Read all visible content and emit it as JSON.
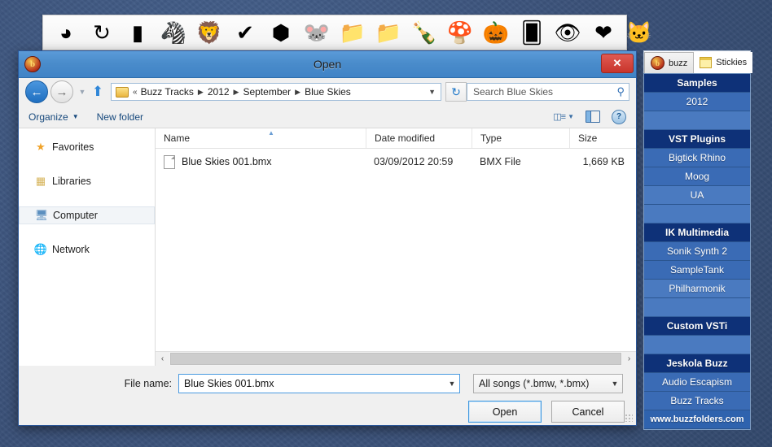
{
  "dock": {
    "icons": [
      {
        "name": "chrome-pie-icon",
        "glyph": "◕"
      },
      {
        "name": "recycle-arrows-icon",
        "glyph": "↻"
      },
      {
        "name": "equalizer-chart-icon",
        "glyph": "▮"
      },
      {
        "name": "zebra-icon",
        "glyph": "🦓"
      },
      {
        "name": "lion-icon",
        "glyph": "🦁"
      },
      {
        "name": "checkmark-monitor-icon",
        "glyph": "✔"
      },
      {
        "name": "colored-cubes-icon",
        "glyph": "⬢"
      },
      {
        "name": "mouse-character-icon",
        "glyph": "🐭"
      },
      {
        "name": "dropbox-folder-icon",
        "glyph": "📁"
      },
      {
        "name": "download-folder-icon",
        "glyph": "📁"
      },
      {
        "name": "whiskey-bottle-icon",
        "glyph": "🍾"
      },
      {
        "name": "mushroom-icon",
        "glyph": "🍄"
      },
      {
        "name": "pumpkin-icon",
        "glyph": "🎃"
      },
      {
        "name": "playing-cards-icon",
        "glyph": "🂠"
      },
      {
        "name": "eye-icon",
        "glyph": "👁"
      },
      {
        "name": "heart-icon",
        "glyph": "❤"
      },
      {
        "name": "cat-icon",
        "glyph": "🐱"
      }
    ]
  },
  "dialog": {
    "title": "Open",
    "title_icon": "b",
    "close_label": "✕",
    "nav": {
      "back_label": "←",
      "forward_label": "→",
      "history_label": "▼",
      "up_label": "⬆",
      "refresh_label": "↻",
      "address_dropdown": "▼",
      "breadcrumb_prefix": "«",
      "breadcrumbs": [
        "Buzz Tracks",
        "2012",
        "September",
        "Blue Skies"
      ],
      "crumb_separator": "▶"
    },
    "search": {
      "placeholder": "Search Blue Skies",
      "value": "",
      "icon": "search-icon"
    },
    "commands": {
      "organize": "Organize",
      "organize_caret": "▼",
      "new_folder": "New folder",
      "view_caret": "▼",
      "help_label": "?"
    },
    "nav_pane": [
      {
        "label": "Favorites",
        "icon": "star-icon",
        "glyph": "★",
        "selected": false
      },
      {
        "label": "Libraries",
        "icon": "libraries-icon",
        "glyph": "▤",
        "selected": false
      },
      {
        "label": "Computer",
        "icon": "computer-icon",
        "glyph": "🖳",
        "selected": true
      },
      {
        "label": "Network",
        "icon": "network-icon",
        "glyph": "🌐",
        "selected": false
      }
    ],
    "columns": [
      "Name",
      "Date modified",
      "Type",
      "Size"
    ],
    "sort_indicator": "▲",
    "files": [
      {
        "name": "Blue Skies 001.bmx",
        "date_modified": "03/09/2012 20:59",
        "type": "BMX File",
        "size": "1,669 KB"
      }
    ],
    "scrollbar": {
      "left_arrow": "‹",
      "right_arrow": "›"
    },
    "footer": {
      "filename_label": "File name:",
      "filename_value": "Blue Skies 001.bmx",
      "filename_caret": "▼",
      "filter_value": "All songs (*.bmw, *.bmx)",
      "filter_caret": "▼",
      "open_label": "Open",
      "cancel_label": "Cancel"
    }
  },
  "buzz_panel": {
    "tabs": [
      {
        "label": "buzz",
        "icon": "buzz-ball-icon",
        "icon_text": "b",
        "active": true
      },
      {
        "label": "Stickies",
        "icon": "sticky-note-icon",
        "active": false
      }
    ],
    "items": [
      {
        "label": "Samples",
        "style": "hdr"
      },
      {
        "label": "2012",
        "style": "item"
      },
      {
        "label": "",
        "style": "gap"
      },
      {
        "label": "VST Plugins",
        "style": "hdr"
      },
      {
        "label": "Bigtick Rhino",
        "style": "item"
      },
      {
        "label": "Moog",
        "style": "item"
      },
      {
        "label": "UA",
        "style": "alt"
      },
      {
        "label": "",
        "style": "gap"
      },
      {
        "label": "IK Multimedia",
        "style": "hdr"
      },
      {
        "label": "Sonik Synth 2",
        "style": "item"
      },
      {
        "label": "SampleTank",
        "style": "item"
      },
      {
        "label": "Philharmonik",
        "style": "alt"
      },
      {
        "label": "",
        "style": "gap"
      },
      {
        "label": "Custom VSTi",
        "style": "hdr"
      },
      {
        "label": "",
        "style": "gap"
      },
      {
        "label": "Jeskola Buzz",
        "style": "hdr"
      },
      {
        "label": "Audio Escapism",
        "style": "item"
      },
      {
        "label": "Buzz Tracks",
        "style": "item"
      },
      {
        "label": "www.buzzfolders.com",
        "style": "web"
      }
    ]
  },
  "colors": {
    "desktop": "#3c5580",
    "title_bar": "#4a8ccb",
    "close_button": "#c8352c",
    "panel_header": "#0e3178",
    "panel_item": "#3a6bb5",
    "panel_alt": "#4a7ac0",
    "accent_link": "#16487c"
  }
}
